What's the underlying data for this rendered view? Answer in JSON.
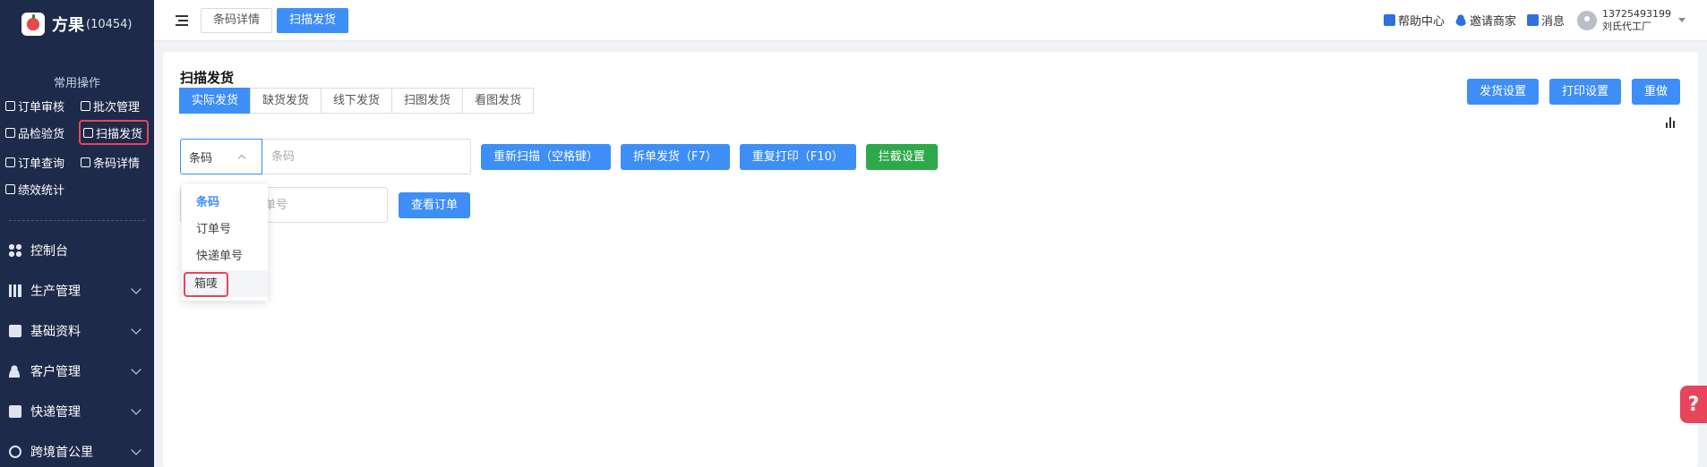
{
  "brand": {
    "name": "方果",
    "code": "(10454)"
  },
  "sidebar": {
    "section_title": "常用操作",
    "quick_items": [
      {
        "label": "订单审核",
        "icon": "checkbox-icon"
      },
      {
        "label": "批次管理",
        "icon": "batch-icon"
      },
      {
        "label": "品检验货",
        "icon": "inspect-icon"
      },
      {
        "label": "扫描发货",
        "icon": "scan-icon",
        "active": true
      },
      {
        "label": "订单查询",
        "icon": "search-doc-icon"
      },
      {
        "label": "条码详情",
        "icon": "barcode-icon"
      },
      {
        "label": "绩效统计",
        "icon": "stats-icon"
      }
    ],
    "menu": [
      {
        "label": "控制台",
        "icon": "dashboard-icon",
        "expandable": false
      },
      {
        "label": "生产管理",
        "icon": "books-icon",
        "expandable": true
      },
      {
        "label": "基础资料",
        "icon": "box-icon",
        "expandable": true
      },
      {
        "label": "客户管理",
        "icon": "user-icon",
        "expandable": true
      },
      {
        "label": "快递管理",
        "icon": "truck-icon",
        "expandable": true
      },
      {
        "label": "跨境首公里",
        "icon": "globe-icon",
        "expandable": true
      }
    ]
  },
  "topbar": {
    "tabs": [
      {
        "label": "条码详情",
        "active": false
      },
      {
        "label": "扫描发货",
        "active": true
      }
    ],
    "help": "帮助中心",
    "invite": "邀请商家",
    "messages": "消息",
    "user_phone": "13725493199",
    "user_org": "刘氏代工厂"
  },
  "main": {
    "title": "扫描发货",
    "subtabs": [
      {
        "label": "实际发货",
        "active": true
      },
      {
        "label": "缺货发货",
        "active": false
      },
      {
        "label": "线下发货",
        "active": false
      },
      {
        "label": "扫图发货",
        "active": false
      },
      {
        "label": "看图发货",
        "active": false
      }
    ],
    "right_buttons": {
      "ship_settings": "发货设置",
      "print_settings": "打印设置",
      "redo": "重做"
    },
    "scan": {
      "select_value": "条码",
      "input_placeholder": "条码",
      "rescan_button": "重新扫描（空格键）",
      "split_button": "拆单发货（F7）",
      "reprint_button": "重复打印（F10）",
      "intercept_button": "拦截设置"
    },
    "order": {
      "input_placeholder": "递单号",
      "view_button": "查看订单"
    },
    "dropdown_options": [
      {
        "label": "条码",
        "selected": true
      },
      {
        "label": "订单号",
        "selected": false
      },
      {
        "label": "快递单号",
        "selected": false
      },
      {
        "label": "箱唛",
        "selected": false,
        "highlighted": true
      }
    ]
  },
  "colors": {
    "primary": "#3e8ef7",
    "sidebar": "#1e2a4a",
    "green": "#2ea94a",
    "highlight": "#e8445a"
  }
}
